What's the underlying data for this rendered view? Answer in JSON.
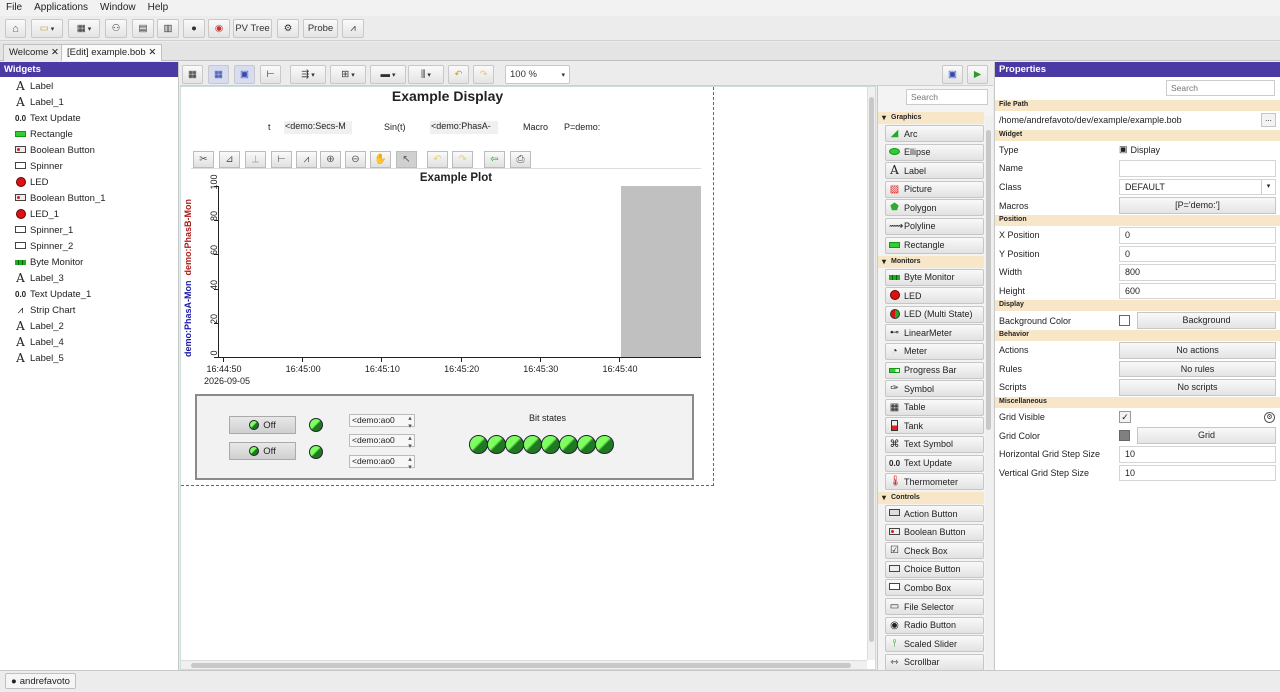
{
  "menu": [
    "File",
    "Applications",
    "Window",
    "Help"
  ],
  "toolbar": {
    "pvtree": "PV Tree",
    "probe": "Probe"
  },
  "tabs": [
    "Welcome ✕",
    "[Edit] example.bob ✕"
  ],
  "widgets": {
    "title": "Widgets",
    "items": [
      {
        "icon": "A",
        "label": "Label"
      },
      {
        "icon": "A",
        "label": "Label_1"
      },
      {
        "icon": "0.0",
        "label": "Text Update"
      },
      {
        "icon": "rect",
        "label": "Rectangle"
      },
      {
        "icon": "bool",
        "label": "Boolean Button"
      },
      {
        "icon": "spin",
        "label": "Spinner"
      },
      {
        "icon": "led",
        "label": "LED"
      },
      {
        "icon": "bool",
        "label": "Boolean Button_1"
      },
      {
        "icon": "led",
        "label": "LED_1"
      },
      {
        "icon": "spin",
        "label": "Spinner_1"
      },
      {
        "icon": "spin",
        "label": "Spinner_2"
      },
      {
        "icon": "byte",
        "label": "Byte Monitor"
      },
      {
        "icon": "A",
        "label": "Label_3"
      },
      {
        "icon": "0.0",
        "label": "Text Update_1"
      },
      {
        "icon": "strip",
        "label": "Strip Chart"
      },
      {
        "icon": "A",
        "label": "Label_2"
      },
      {
        "icon": "A",
        "label": "Label_4"
      },
      {
        "icon": "A",
        "label": "Label_5"
      }
    ]
  },
  "editor": {
    "zoom": "100 %"
  },
  "display": {
    "title": "Example Display",
    "t_label": "t",
    "secs": "<demo:Secs-M",
    "sin_label": "Sin(t)",
    "phasA": "<demo:PhasA-",
    "macro_label": "Macro",
    "macro_val": "P=demo:",
    "plot_title": "Example Plot",
    "ylabel_a": "demo:PhasA-Mon",
    "ylabel_b": "demo:PhasB-Mon",
    "yticks": [
      "100",
      "80",
      "60",
      "40",
      "20",
      "0"
    ],
    "xticks": [
      "16:44:50",
      "16:45:00",
      "16:45:10",
      "16:45:20",
      "16:45:30",
      "16:45:40"
    ],
    "xdate": "2026-09-05",
    "off1": "Off",
    "off2": "Off",
    "spin1": "<demo:ao0",
    "spin2": "<demo:ao0",
    "spin3": "<demo:ao0",
    "bit_label": "Bit states"
  },
  "palette": {
    "search": "Search",
    "categories": [
      {
        "name": "Graphics",
        "items": [
          {
            "icon": "arc",
            "label": "Arc"
          },
          {
            "icon": "ellipse",
            "label": "Ellipse"
          },
          {
            "icon": "A",
            "label": "Label"
          },
          {
            "icon": "picture",
            "label": "Picture"
          },
          {
            "icon": "polygon",
            "label": "Polygon"
          },
          {
            "icon": "polyline",
            "label": "Polyline"
          },
          {
            "icon": "rect",
            "label": "Rectangle"
          }
        ]
      },
      {
        "name": "Monitors",
        "items": [
          {
            "icon": "byte",
            "label": "Byte Monitor"
          },
          {
            "icon": "led",
            "label": "LED"
          },
          {
            "icon": "ledm",
            "label": "LED (Multi State)"
          },
          {
            "icon": "linear",
            "label": "LinearMeter"
          },
          {
            "icon": "meter",
            "label": "Meter"
          },
          {
            "icon": "progress",
            "label": "Progress Bar"
          },
          {
            "icon": "symbol",
            "label": "Symbol"
          },
          {
            "icon": "table",
            "label": "Table"
          },
          {
            "icon": "tank",
            "label": "Tank"
          },
          {
            "icon": "textsym",
            "label": "Text Symbol"
          },
          {
            "icon": "0.0",
            "label": "Text Update"
          },
          {
            "icon": "thermo",
            "label": "Thermometer"
          }
        ]
      },
      {
        "name": "Controls",
        "items": [
          {
            "icon": "action",
            "label": "Action Button"
          },
          {
            "icon": "bool",
            "label": "Boolean Button"
          },
          {
            "icon": "check",
            "label": "Check Box"
          },
          {
            "icon": "choice",
            "label": "Choice Button"
          },
          {
            "icon": "combo",
            "label": "Combo Box"
          },
          {
            "icon": "file",
            "label": "File Selector"
          },
          {
            "icon": "radio",
            "label": "Radio Button"
          },
          {
            "icon": "slider",
            "label": "Scaled Slider"
          },
          {
            "icon": "scroll",
            "label": "Scrollbar"
          }
        ]
      }
    ]
  },
  "properties": {
    "title": "Properties",
    "search": "Search",
    "sections": [
      {
        "name": "File Path",
        "rows": [
          {
            "key": "",
            "val": "/home/andrefavoto/dev/example/example.bob",
            "kind": "path"
          }
        ]
      },
      {
        "name": "Widget",
        "rows": [
          {
            "key": "Type",
            "val": "Display",
            "kind": "plain"
          },
          {
            "key": "Name",
            "val": "",
            "kind": "field"
          },
          {
            "key": "Class",
            "val": "DEFAULT",
            "kind": "combo"
          },
          {
            "key": "Macros",
            "val": "[P='demo:']",
            "kind": "button"
          }
        ]
      },
      {
        "name": "Position",
        "rows": [
          {
            "key": "X Position",
            "val": "0",
            "kind": "field"
          },
          {
            "key": "Y Position",
            "val": "0",
            "kind": "field"
          },
          {
            "key": "Width",
            "val": "800",
            "kind": "field"
          },
          {
            "key": "Height",
            "val": "600",
            "kind": "field"
          }
        ]
      },
      {
        "name": "Display",
        "rows": [
          {
            "key": "Background Color",
            "val": "Background",
            "kind": "color"
          }
        ]
      },
      {
        "name": "Behavior",
        "rows": [
          {
            "key": "Actions",
            "val": "No actions",
            "kind": "button"
          },
          {
            "key": "Rules",
            "val": "No rules",
            "kind": "button"
          },
          {
            "key": "Scripts",
            "val": "No scripts",
            "kind": "button"
          }
        ]
      },
      {
        "name": "Miscellaneous",
        "rows": [
          {
            "key": "Grid Visible",
            "val": "✓",
            "kind": "check"
          },
          {
            "key": "Grid Color",
            "val": "Grid",
            "kind": "color"
          },
          {
            "key": "Horizontal Grid Step Size",
            "val": "10",
            "kind": "field"
          },
          {
            "key": "Vertical Grid Step Size",
            "val": "10",
            "kind": "field"
          }
        ]
      }
    ]
  },
  "status": {
    "user": "andrefavoto"
  },
  "colors": {
    "header": "#4b3aa3",
    "section": "#f7e6c8",
    "led_on": "#7dff5f"
  }
}
